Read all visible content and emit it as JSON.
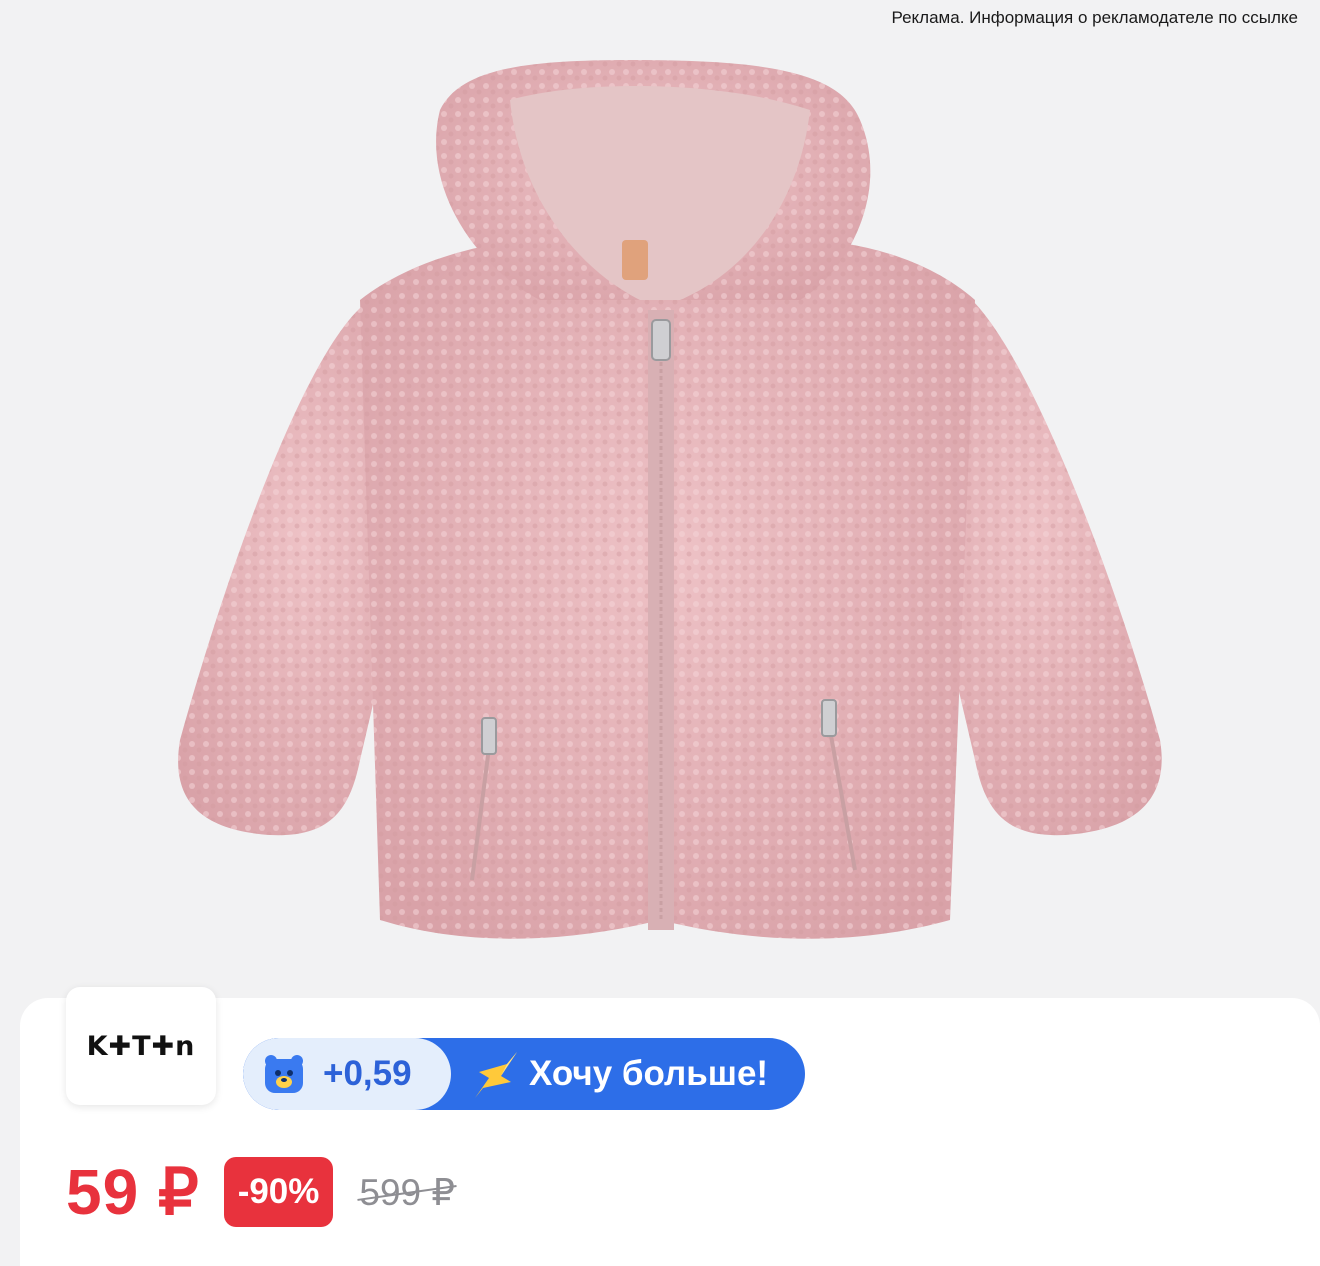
{
  "ad": {
    "disclaimer": "Реклама. Информация о рекламодателе по ссылке"
  },
  "product": {
    "image_icon": "pink-fleece-hooded-jacket-image",
    "colors": {
      "fur": "#e7b7bc",
      "lining": "#e4c5c6",
      "zipper": "#c9a0a3"
    }
  },
  "brand": {
    "logo_text": "K✚T✚n"
  },
  "bonus": {
    "icon": "bear-icon",
    "amount": "+0,59",
    "cta_icon": "sparkle-star-icon",
    "cta_label": "Хочу больше!",
    "colors": {
      "pill_blue": "#2d6ee8",
      "left_bg": "#e4eefc"
    }
  },
  "price": {
    "current": "59 ₽",
    "discount": "-90%",
    "old": "599 ₽",
    "colors": {
      "accent_red": "#e8323d",
      "muted_gray": "#8e8e93"
    }
  }
}
